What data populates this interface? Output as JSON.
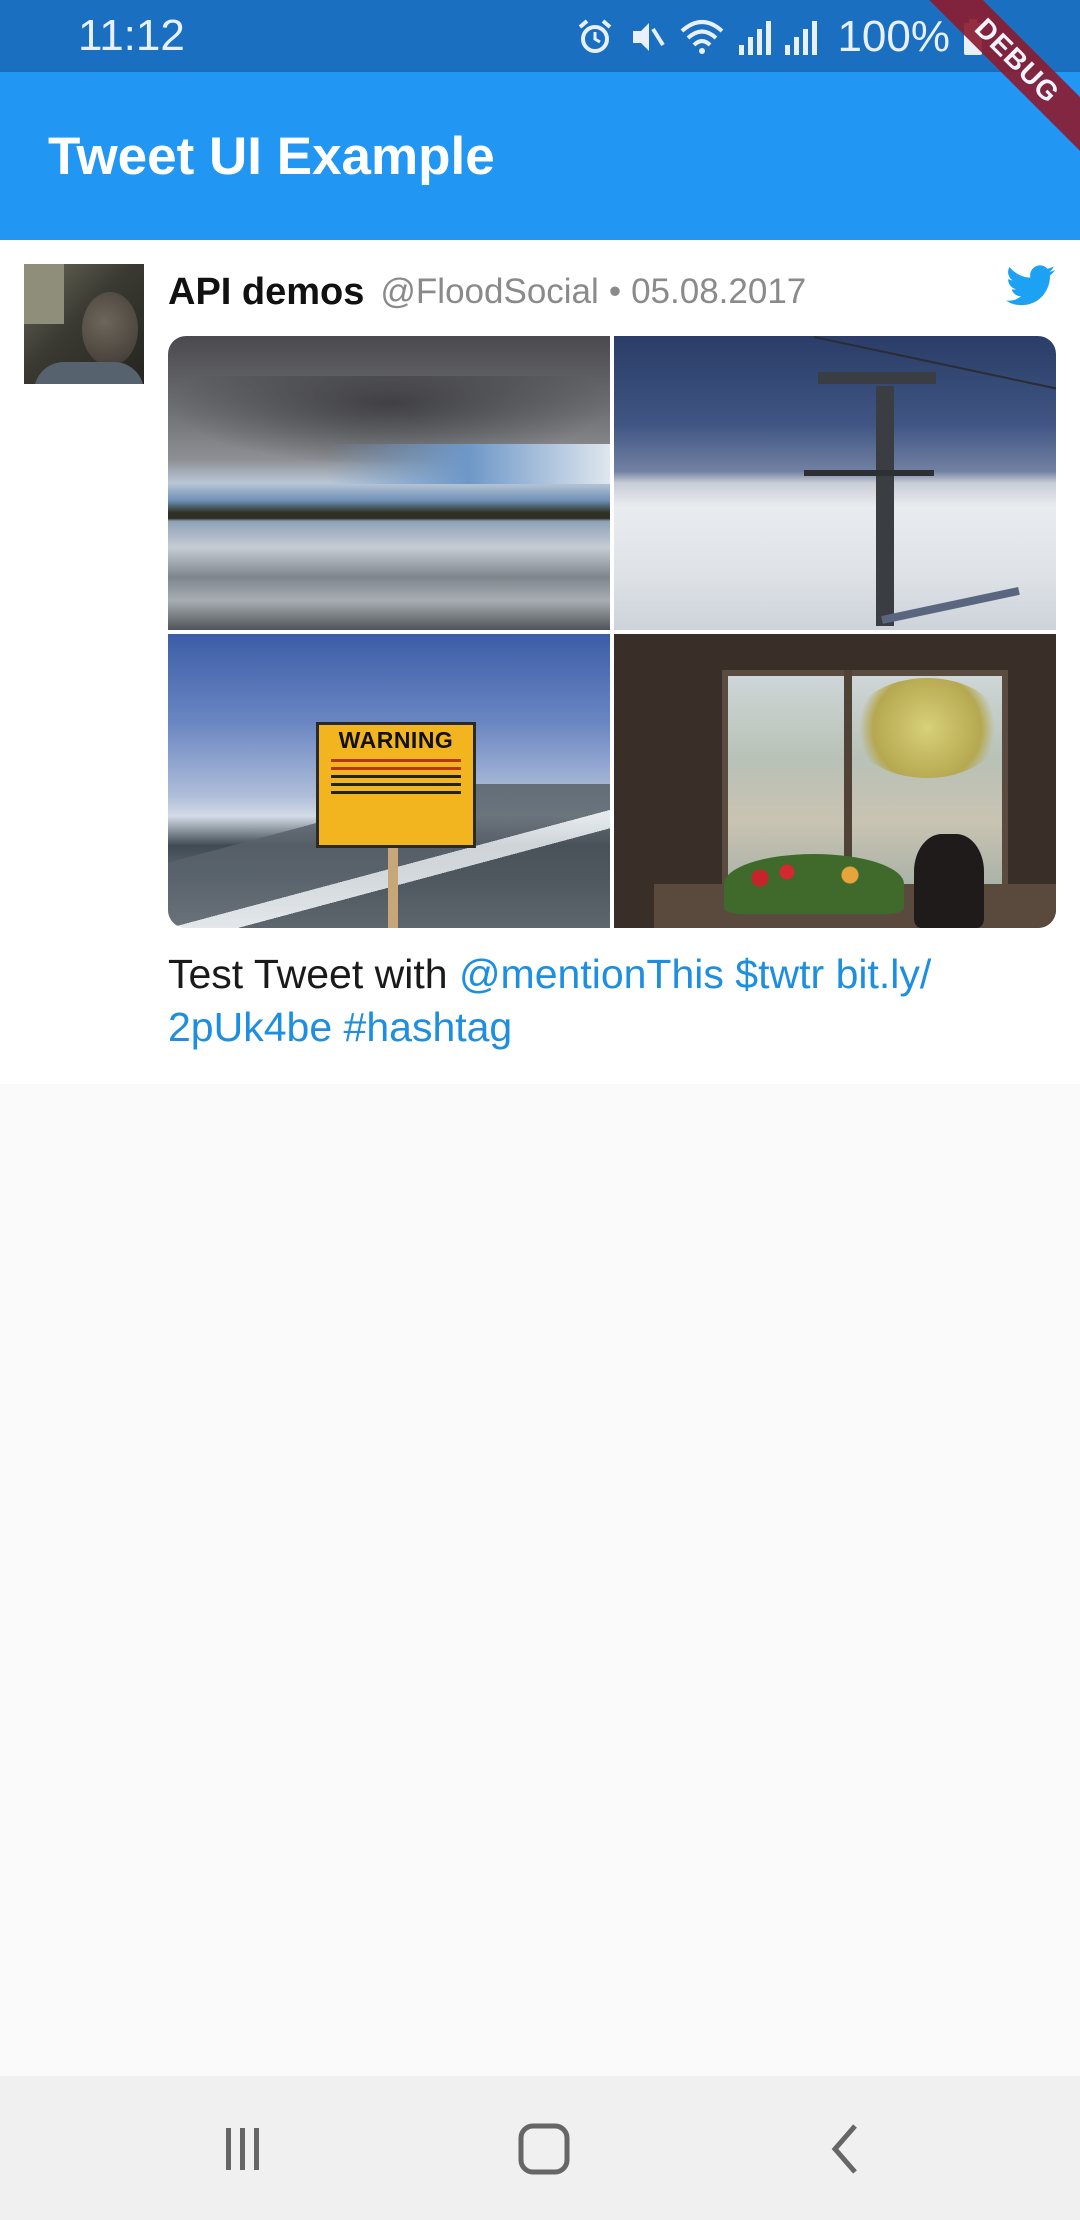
{
  "status_bar": {
    "time": "11:12",
    "battery": "100%",
    "icons": [
      "alarm-icon",
      "mute-icon",
      "wifi-icon",
      "signal-icon",
      "signal-icon",
      "battery-icon"
    ]
  },
  "debug_banner": "DEBUG",
  "app_bar": {
    "title": "Tweet UI Example"
  },
  "tweet": {
    "name": "API demos",
    "handle": "@FloodSocial",
    "separator": "•",
    "date": "05.08.2017",
    "media": [
      {
        "name": "lake-photo"
      },
      {
        "name": "ski-lift-photo"
      },
      {
        "name": "warning-sign-photo",
        "sign_text": "WARNING"
      },
      {
        "name": "cat-window-photo"
      }
    ],
    "text": {
      "plain": "Test Tweet with ",
      "mention": "@mentionThis",
      "cashtag": "$twtr",
      "url": "bit.ly/​2pUk4be",
      "hashtag": "#hashtag"
    }
  },
  "colors": {
    "status_bar": "#1b6fc0",
    "app_bar": "#2196f3",
    "link": "#1e8ee0",
    "twitter_blue": "#1da1f2",
    "debug_ribbon": "#8b1d33"
  },
  "nav_bar": {
    "buttons": [
      "recent-apps-icon",
      "home-icon",
      "back-icon"
    ]
  }
}
